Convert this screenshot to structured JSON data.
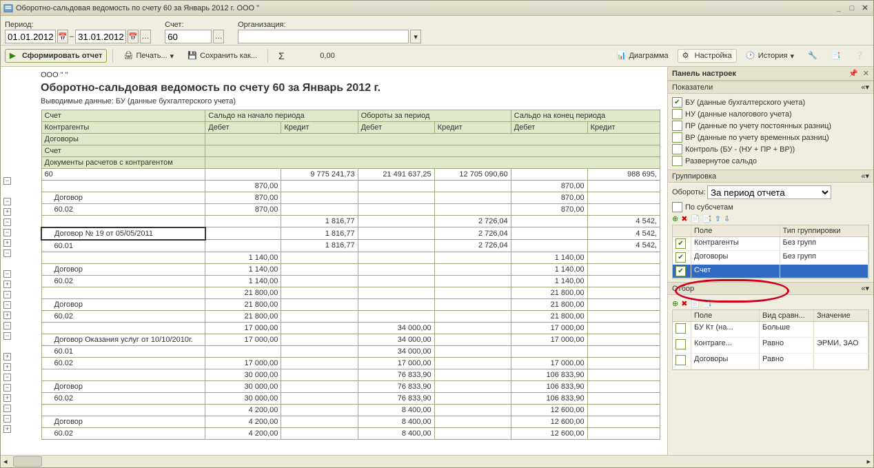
{
  "window": {
    "title": "Оборотно-сальдовая ведомость по счету 60 за Январь 2012 г. ООО \""
  },
  "toolbar1": {
    "period_label": "Период:",
    "date_from": "01.01.2012",
    "date_to": "31.01.2012",
    "sep": "–",
    "account_label": "Счет:",
    "account_value": "60",
    "org_label": "Организация:",
    "org_value": ""
  },
  "toolbar2": {
    "form_report": "Сформировать отчет",
    "print": "Печать...",
    "save_as": "Сохранить как...",
    "sigma": "Σ",
    "sigma_value": "0,00",
    "diagram": "Диаграмма",
    "settings": "Настройка",
    "history": "История"
  },
  "report": {
    "org": "ООО \" \"",
    "title": "Оборотно-сальдовая ведомость по счету 60 за Январь 2012 г.",
    "subtitle": "Выводимые данные:  БУ (данные бухгалтерского учета)",
    "head_r1": {
      "acct": "Счет",
      "sb": "Сальдо на начало периода",
      "turn": "Обороты за период",
      "se": "Сальдо на конец периода"
    },
    "head_r2": {
      "a": "Контрагенты",
      "d": "Дебет",
      "c": "Кредит"
    },
    "head_r3": "Договоры",
    "head_r4": "Счет",
    "head_r5": "Документы расчетов с контрагентом",
    "rows": [
      {
        "a": "60",
        "sd": "",
        "sc": "9 775 241,73",
        "td": "21 491 637,25",
        "tc": "12 705 090,60",
        "ed": "",
        "ec": "988 695,"
      },
      {
        "a": "",
        "sd": "870,00",
        "sc": "",
        "td": "",
        "tc": "",
        "ed": "870,00",
        "ec": ""
      },
      {
        "a": "Договор",
        "sd": "870,00",
        "sc": "",
        "td": "",
        "tc": "",
        "ed": "870,00",
        "ec": ""
      },
      {
        "a": "60.02",
        "sd": "870,00",
        "sc": "",
        "td": "",
        "tc": "",
        "ed": "870,00",
        "ec": ""
      },
      {
        "a": "",
        "sd": "",
        "sc": "1 816,77",
        "td": "",
        "tc": "2 726,04",
        "ed": "",
        "ec": "4 542,"
      },
      {
        "a": "Договор № 19 от 05/05/2011",
        "sd": "",
        "sc": "1 816,77",
        "td": "",
        "tc": "2 726,04",
        "ed": "",
        "ec": "4 542,",
        "sel": true
      },
      {
        "a": "60.01",
        "sd": "",
        "sc": "1 816,77",
        "td": "",
        "tc": "2 726,04",
        "ed": "",
        "ec": "4 542,"
      },
      {
        "a": "",
        "sd": "1 140,00",
        "sc": "",
        "td": "",
        "tc": "",
        "ed": "1 140,00",
        "ec": ""
      },
      {
        "a": "Договор",
        "sd": "1 140,00",
        "sc": "",
        "td": "",
        "tc": "",
        "ed": "1 140,00",
        "ec": ""
      },
      {
        "a": "60.02",
        "sd": "1 140,00",
        "sc": "",
        "td": "",
        "tc": "",
        "ed": "1 140,00",
        "ec": ""
      },
      {
        "a": "",
        "sd": "21 800,00",
        "sc": "",
        "td": "",
        "tc": "",
        "ed": "21 800,00",
        "ec": ""
      },
      {
        "a": "Договор",
        "sd": "21 800,00",
        "sc": "",
        "td": "",
        "tc": "",
        "ed": "21 800,00",
        "ec": ""
      },
      {
        "a": "60.02",
        "sd": "21 800,00",
        "sc": "",
        "td": "",
        "tc": "",
        "ed": "21 800,00",
        "ec": ""
      },
      {
        "a": "",
        "sd": "17 000,00",
        "sc": "",
        "td": "34 000,00",
        "tc": "",
        "ed": "17 000,00",
        "ec": ""
      },
      {
        "a": "Договор Оказания услуг от 10/10/2010г.",
        "sd": "17 000,00",
        "sc": "",
        "td": "34 000,00",
        "tc": "",
        "ed": "17 000,00",
        "ec": ""
      },
      {
        "a": "60.01",
        "sd": "",
        "sc": "",
        "td": "34 000,00",
        "tc": "",
        "ed": "",
        "ec": ""
      },
      {
        "a": "60.02",
        "sd": "17 000,00",
        "sc": "",
        "td": "17 000,00",
        "tc": "",
        "ed": "17 000,00",
        "ec": ""
      },
      {
        "a": "",
        "sd": "30 000,00",
        "sc": "",
        "td": "76 833,90",
        "tc": "",
        "ed": "106 833,90",
        "ec": ""
      },
      {
        "a": "Договор",
        "sd": "30 000,00",
        "sc": "",
        "td": "76 833,90",
        "tc": "",
        "ed": "106 833,90",
        "ec": ""
      },
      {
        "a": "60.02",
        "sd": "30 000,00",
        "sc": "",
        "td": "76 833,90",
        "tc": "",
        "ed": "106 833,90",
        "ec": ""
      },
      {
        "a": "",
        "sd": "4 200,00",
        "sc": "",
        "td": "8 400,00",
        "tc": "",
        "ed": "12 600,00",
        "ec": ""
      },
      {
        "a": "Договор",
        "sd": "4 200,00",
        "sc": "",
        "td": "8 400,00",
        "tc": "",
        "ed": "12 600,00",
        "ec": ""
      },
      {
        "a": "60.02",
        "sd": "4 200,00",
        "sc": "",
        "td": "8 400,00",
        "tc": "",
        "ed": "12 600,00",
        "ec": ""
      }
    ],
    "tree": [
      "-",
      "",
      "-",
      "+",
      "-",
      "-",
      "+",
      "-",
      "",
      "-",
      "+",
      "-",
      "-",
      "+",
      "-",
      "-",
      "",
      "+",
      "+",
      "-",
      "-",
      "+",
      "-",
      "-",
      "+"
    ]
  },
  "side": {
    "panel_title": "Панель настроек",
    "pokazateli": {
      "title": "Показатели",
      "items": [
        {
          "c": true,
          "t": "БУ (данные бухгалтерского учета)"
        },
        {
          "c": false,
          "t": "НУ (данные налогового учета)"
        },
        {
          "c": false,
          "t": "ПР (данные по учету постоянных разниц)"
        },
        {
          "c": false,
          "t": "ВР (данные по учету временных разниц)"
        },
        {
          "c": false,
          "t": "Контроль (БУ - (НУ + ПР + ВР))"
        },
        {
          "c": false,
          "t": "Развернутое сальдо"
        }
      ]
    },
    "grp": {
      "title": "Группировка",
      "turnover_label": "Обороты:",
      "turnover_value": "За период отчета",
      "subaccounts": "По субсчетам",
      "grid_hdr": {
        "f": "Поле",
        "t": "Тип группировки"
      },
      "rows": [
        {
          "c": true,
          "f": "Контрагенты",
          "t": "Без групп"
        },
        {
          "c": true,
          "f": "Договоры",
          "t": "Без групп"
        },
        {
          "c": true,
          "f": "Счет",
          "t": "",
          "sel": true
        }
      ]
    },
    "filter": {
      "title": "Отбор",
      "grid_hdr": {
        "f": "Поле",
        "c": "Вид сравн...",
        "v": "Значение"
      },
      "rows": [
        {
          "on": false,
          "f": "БУ Кт (на...",
          "c": "Больше",
          "v": ""
        },
        {
          "on": false,
          "f": "Контраге...",
          "c": "Равно",
          "v": "ЭРМИ, ЗАО"
        },
        {
          "on": false,
          "f": "Договоры",
          "c": "Равно",
          "v": ""
        }
      ]
    }
  }
}
